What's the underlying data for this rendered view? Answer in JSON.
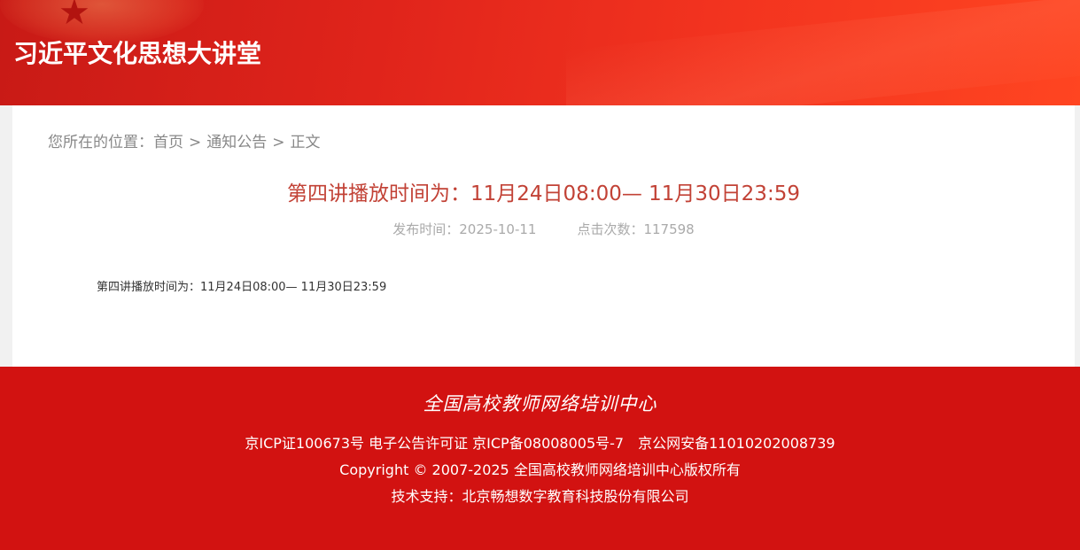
{
  "header": {
    "title": "习近平文化思想大讲堂",
    "star_icon": "star-icon"
  },
  "breadcrumb": {
    "prefix": "您所在的位置：",
    "home": "首页",
    "separator": ">",
    "section": "通知公告",
    "current": "正文"
  },
  "article": {
    "title": "第四讲播放时间为：11月24日08:00— 11月30日23:59",
    "publish_label": "发布时间：2025-10-11",
    "clicks_label": "点击次数：117598",
    "body": "第四讲播放时间为：11月24日08:00— 11月30日23:59"
  },
  "footer": {
    "logo_text": "全国高校教师网络培训中心",
    "icp": "京ICP证100673号 电子公告许可证 京ICP备08008005号-7　京公网安备11010202008739",
    "copyright": "Copyright © 2007-2025 全国高校教师网络培训中心版权所有",
    "support": "技术支持：北京畅想数字教育科技股份有限公司"
  },
  "colors": {
    "header_red": "#e0241b",
    "footer_red": "#d21211",
    "title_red": "#c24236"
  }
}
